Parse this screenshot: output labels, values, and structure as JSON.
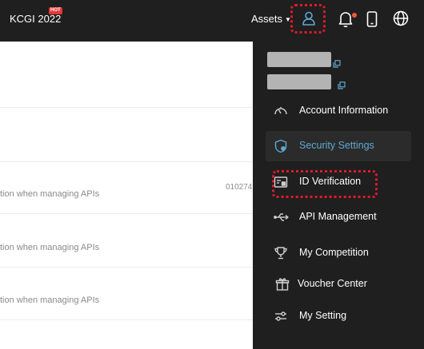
{
  "header": {
    "brand": "KCGI 2022",
    "hot_badge": "HOT",
    "assets_label": "Assets",
    "icons": [
      "user-icon",
      "bell-icon",
      "phone-icon",
      "globe-icon"
    ],
    "accent_color": "#5fa8d3",
    "highlight_color": "#e0192c",
    "notification_dot_color": "#f25a3c"
  },
  "content": {
    "rows": [
      {
        "text": "tion when managing APIs",
        "number": "010274"
      },
      {
        "text": "tion when managing APIs"
      },
      {
        "text": "tion when managing APIs"
      }
    ]
  },
  "panel": {
    "menu": [
      {
        "label": "Account Information",
        "icon": "speedometer-icon"
      },
      {
        "label": "Security Settings",
        "icon": "shield-icon",
        "active": true
      },
      {
        "label": "ID Verification",
        "icon": "id-card-icon",
        "highlighted": true
      },
      {
        "label": "API Management",
        "icon": "usb-icon"
      },
      {
        "label": "My Competition",
        "icon": "trophy-icon"
      },
      {
        "label": "Voucher Center",
        "icon": "gift-icon"
      },
      {
        "label": "My Setting",
        "icon": "sliders-icon"
      }
    ]
  }
}
